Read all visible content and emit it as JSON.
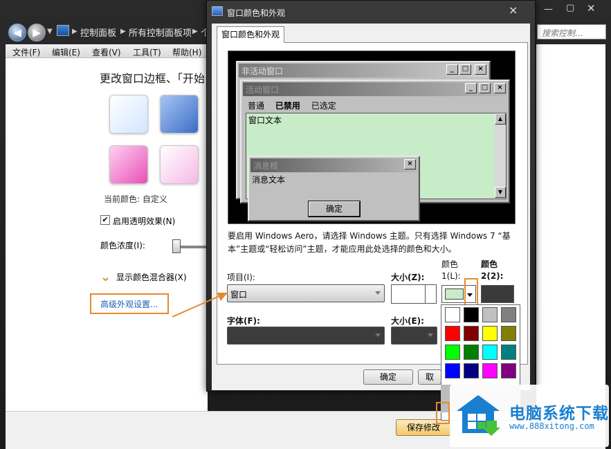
{
  "background_window": {
    "breadcrumbs": [
      "控制面板",
      "所有控制面板项",
      "个"
    ],
    "search_placeholder": "搜索控制...",
    "menu": [
      "文件(F)",
      "编辑(E)",
      "查看(V)",
      "工具(T)",
      "帮助(H)"
    ],
    "heading": "更改窗口边框、「开始",
    "current_color": "当前颜色: 自定义",
    "transparency_label": "启用透明效果(N)",
    "transparency_checked": true,
    "intensity_label": "颜色浓度(I):",
    "mixer_label": "显示颜色混合器(X)",
    "advanced_link": "高级外观设置...",
    "save_button": "保存修改",
    "swatch_colors": [
      "#dceeff",
      "#4a7fd0",
      "#f070c8",
      "#f8c8f0"
    ]
  },
  "dialog": {
    "title": "窗口颜色和外观",
    "close": "×",
    "tab": "窗口颜色和外观",
    "preview": {
      "inactive_title": "非活动窗口",
      "active_title": "活动窗口",
      "menu_items": [
        "普通",
        "已禁用",
        "已选定"
      ],
      "window_text": "窗口文本",
      "msgbox_title": "消息框",
      "msgbox_text": "消息文本",
      "ok": "确定"
    },
    "info_text": "要启用 Windows Aero，请选择 Windows 主题。只有选择 Windows 7 “基本”主题或“轻松访问”主题，才能应用此处选择的颜色和大小。",
    "item_label": "项目(I):",
    "item_value": "窗口",
    "size_label": "大小(Z):",
    "color1_label": "颜色 1(L):",
    "color2_label": "颜色 2(2):",
    "color1_value": "#c8ecc8",
    "font_label": "字体(F):",
    "fsize_label": "大小(E):",
    "ok_button": "确定",
    "cancel_button": "取",
    "palette": [
      "#ffffff",
      "#000000",
      "#c0c0c0",
      "#808080",
      "#ff0000",
      "#800000",
      "#ffff00",
      "#808000",
      "#00ff00",
      "#008000",
      "#00ffff",
      "#008080",
      "#0000ff",
      "#000080",
      "#ff00ff",
      "#800080"
    ]
  },
  "watermark": {
    "title": "电脑系统下载",
    "url": "www.888xitong.com"
  },
  "colors": {
    "highlight": "#e58a2e",
    "window_bg": "#c8ecc8",
    "link": "#1a5fb4"
  }
}
